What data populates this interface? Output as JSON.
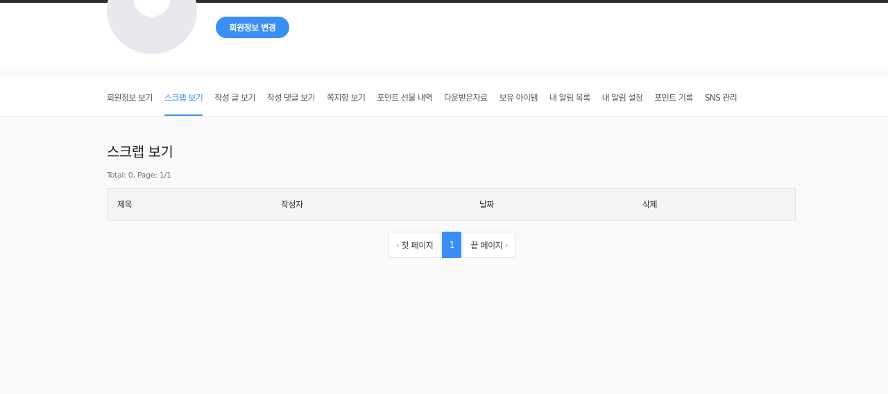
{
  "profile": {
    "edit_button": "회원정보 변경"
  },
  "tabs": [
    {
      "label": "회원정보 보기",
      "active": false
    },
    {
      "label": "스크랩 보기",
      "active": true
    },
    {
      "label": "작성 글 보기",
      "active": false
    },
    {
      "label": "작성 댓글 보기",
      "active": false
    },
    {
      "label": "쪽지함 보기",
      "active": false
    },
    {
      "label": "포인트 선물 내역",
      "active": false
    },
    {
      "label": "다운받은자료",
      "active": false
    },
    {
      "label": "보유 아이템",
      "active": false
    },
    {
      "label": "내 알림 목록",
      "active": false
    },
    {
      "label": "내 알림 설정",
      "active": false
    },
    {
      "label": "포인트 기록",
      "active": false
    },
    {
      "label": "SNS 관리",
      "active": false
    }
  ],
  "main": {
    "title": "스크랩 보기",
    "summary": "Total: 0, Page: 1/1",
    "table": {
      "columns": [
        "제목",
        "작성자",
        "날짜",
        "삭제"
      ],
      "rows": []
    }
  },
  "pagination": {
    "first_label": "첫 페이지",
    "current_page": "1",
    "last_label": "끝 페이지",
    "prev_glyph": "‹",
    "next_glyph": "›"
  },
  "colors": {
    "accent": "#3a8ef6",
    "background": "#fafafa"
  }
}
